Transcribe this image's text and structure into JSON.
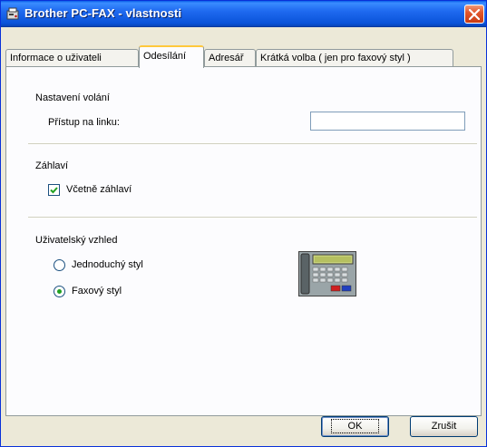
{
  "window": {
    "title": "Brother PC-FAX - vlastnosti"
  },
  "tabs": [
    {
      "label": "Informace o uživateli",
      "active": false
    },
    {
      "label": "Odesílání",
      "active": true
    },
    {
      "label": "Adresář",
      "active": false
    },
    {
      "label": "Krátká volba ( jen pro faxový styl )",
      "active": false
    }
  ],
  "dial_settings": {
    "heading": "Nastavení volání",
    "line_access_label": "Přístup na linku:",
    "line_access_value": ""
  },
  "header": {
    "heading": "Záhlaví",
    "include_header_label": "Včetně záhlaví",
    "include_header_checked": true
  },
  "user_interface": {
    "heading": "Uživatelský vzhled",
    "options": [
      {
        "label": "Jednoduchý styl",
        "selected": false
      },
      {
        "label": "Faxový styl",
        "selected": true
      }
    ]
  },
  "buttons": {
    "ok": "OK",
    "cancel": "Zrušit"
  },
  "colors": {
    "title_bar": "#0a53d9",
    "window_face": "#ece9d8",
    "active_tab_highlight": "#ffc83c",
    "close_button": "#e2572c"
  }
}
